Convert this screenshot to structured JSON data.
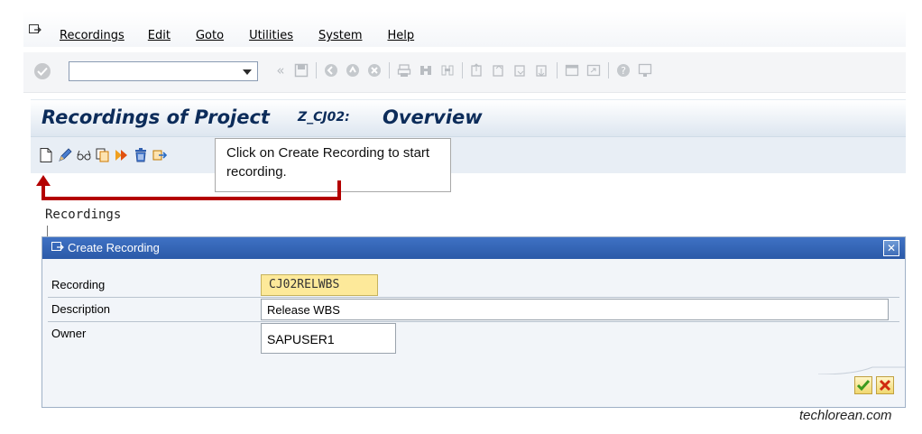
{
  "menu": {
    "items": [
      "Recordings",
      "Edit",
      "Goto",
      "Utilities",
      "System",
      "Help"
    ]
  },
  "toolbar": {
    "command_value": "",
    "back_glyph": "«"
  },
  "title": {
    "prefix": "Recordings of Project",
    "project": "Z_CJ02:",
    "suffix": "Overview"
  },
  "annotation": {
    "text": "Click on Create Recording to start recording."
  },
  "body": {
    "heading": "Recordings"
  },
  "dialog": {
    "title": "Create Recording",
    "close_glyph": "✕",
    "fields": {
      "recording_label": "Recording",
      "recording_value": "CJ02RELWBS",
      "description_label": "Description",
      "description_value": "Release WBS",
      "owner_label": "Owner",
      "owner_value": "SAPUSER1"
    }
  },
  "colors": {
    "title_text": "#0c2c5a",
    "dialog_header": "#2b5aa8",
    "highlight_field": "#fde99a",
    "annotation_arrow": "#b40000"
  },
  "watermark": "techlorean.com"
}
